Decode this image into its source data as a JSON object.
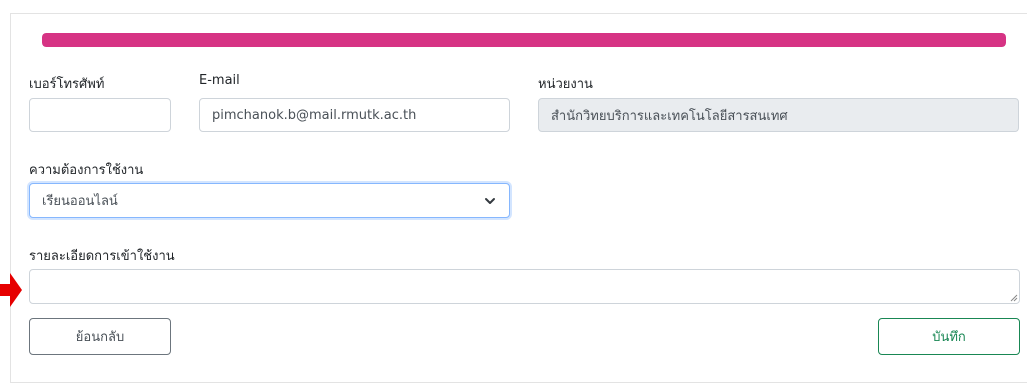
{
  "progress": {
    "value": 1.0,
    "color": "#d63384"
  },
  "phone": {
    "label": "เบอร์โทรศัพท์",
    "value": ""
  },
  "email": {
    "label": "E-mail",
    "value": "pimchanok.b@mail.rmutk.ac.th"
  },
  "department": {
    "label": "หน่วยงาน",
    "value": "สำนักวิทยบริการและเทคโนโลยีสารสนเทศ"
  },
  "requirement": {
    "label": "ความต้องการใช้งาน",
    "selected": "เรียนออนไลน์"
  },
  "details": {
    "label": "รายละเอียดการเข้าใช้งาน",
    "value": ""
  },
  "buttons": {
    "back": "ย้อนกลับ",
    "save": "บันทึก"
  },
  "annotation": {
    "arrow_color": "#e60000"
  },
  "icons": {
    "dropdown": "chevron-down-icon",
    "pointer": "red-arrow-icon"
  }
}
